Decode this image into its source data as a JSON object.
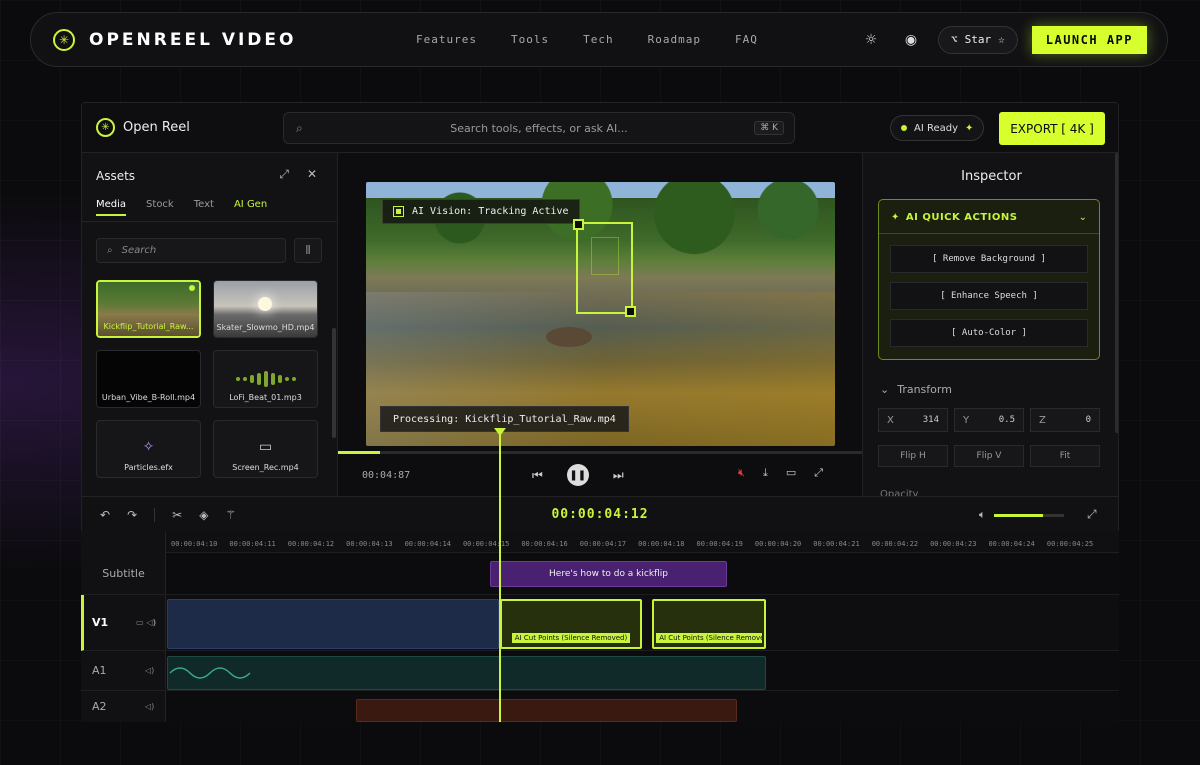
{
  "nav": {
    "brand": "OPENREEL VIDEO",
    "links": [
      "Features",
      "Tools",
      "Tech",
      "Roadmap",
      "FAQ"
    ],
    "star_label": "Star",
    "launch_label": "LAUNCH APP",
    "icons": {
      "theme": "sun-icon",
      "settings": "target-icon",
      "github": "github-icon",
      "star": "star-outline-icon"
    }
  },
  "app": {
    "brand": "Open Reel",
    "search_placeholder": "Search tools, effects, or ask AI...",
    "search_shortcut": "⌘ K",
    "ai_status": "AI Ready",
    "export_label": "EXPORT [ 4K ]",
    "accent_color": "#d7ff2e"
  },
  "assets": {
    "title": "Assets",
    "tabs": [
      "Media",
      "Stock",
      "Text",
      "AI Gen"
    ],
    "active_tab": "Media",
    "search_placeholder": "Search",
    "items": [
      {
        "name": "Kickflip_Tutorial_Raw...",
        "type": "video",
        "selected": true
      },
      {
        "name": "Skater_Slowmo_HD.mp4",
        "type": "video",
        "selected": false
      },
      {
        "name": "Urban_Vibe_B-Roll.mp4",
        "type": "video",
        "selected": false
      },
      {
        "name": "LoFi_Beat_01.mp3",
        "type": "audio",
        "selected": false
      },
      {
        "name": "Particles.efx",
        "type": "effect",
        "selected": false
      },
      {
        "name": "Screen_Rec.mp4",
        "type": "video",
        "selected": false
      }
    ]
  },
  "preview": {
    "vision_label": "AI Vision: Tracking Active",
    "processing_label": "Processing: Kickflip_Tutorial_Raw.mp4",
    "time": "00:04:87",
    "progress": 0.08
  },
  "inspector": {
    "title": "Inspector",
    "quick_actions_title": "AI QUICK ACTIONS",
    "quick_actions": [
      "[ Remove Background ]",
      "[ Enhance Speech ]",
      "[ Auto-Color ]"
    ],
    "transform_title": "Transform",
    "transform": [
      {
        "axis": "X",
        "value": "314"
      },
      {
        "axis": "Y",
        "value": "0.5"
      },
      {
        "axis": "Z",
        "value": "0"
      }
    ],
    "transform_buttons": [
      "Flip H",
      "Flip V",
      "Fit"
    ],
    "opacity_title": "Opacity"
  },
  "timeline": {
    "current_time": "00:00:04:12",
    "volume": 0.7,
    "ruler": [
      "00:00:04:10",
      "00:00:04:11",
      "00:00:04:12",
      "00:00:04:13",
      "00:00:04:14",
      "00:00:04:15",
      "00:00:04:16",
      "00:00:04:17",
      "00:00:04:18",
      "00:00:04:19",
      "00:00:04:20",
      "00:00:04:21",
      "00:00:04:22",
      "00:00:04:23",
      "00:00:04:24",
      "00:00:04:25"
    ],
    "tracks": [
      "Subtitle",
      "V1",
      "A1",
      "A2"
    ],
    "subtitle_clip": "Here's how to do a kickflip",
    "cut_clip_1": "AI Cut Points (Silence Removed)",
    "cut_clip_2": "AI Cut Points (Silence Removed)"
  }
}
